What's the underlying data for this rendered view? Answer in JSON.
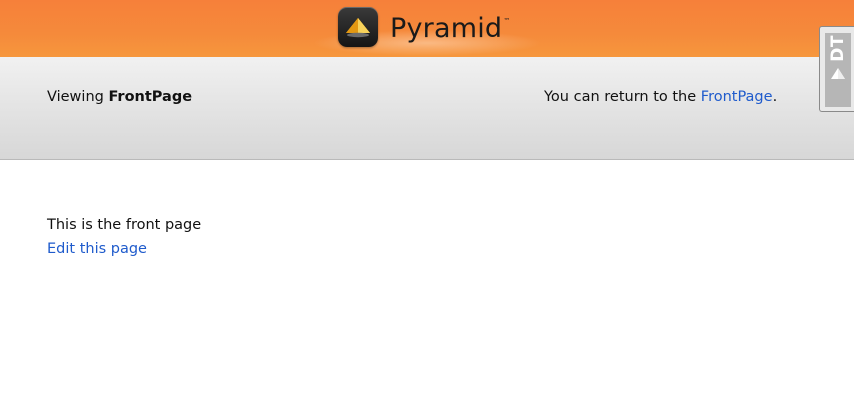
{
  "header": {
    "brand": "Pyramid",
    "trademark": "™"
  },
  "subheader": {
    "viewing_prefix": "Viewing ",
    "viewing_page": "FrontPage",
    "return_prefix": "You can return to the ",
    "return_link": "FrontPage",
    "return_suffix": "."
  },
  "debug_toolbar": {
    "label": "DT"
  },
  "content": {
    "text": "This is the front page",
    "edit_link": "Edit this page"
  },
  "colors": {
    "banner_orange": "#f6803a",
    "link_blue": "#1f5bcc",
    "header_gray": "#e6e6e6"
  }
}
